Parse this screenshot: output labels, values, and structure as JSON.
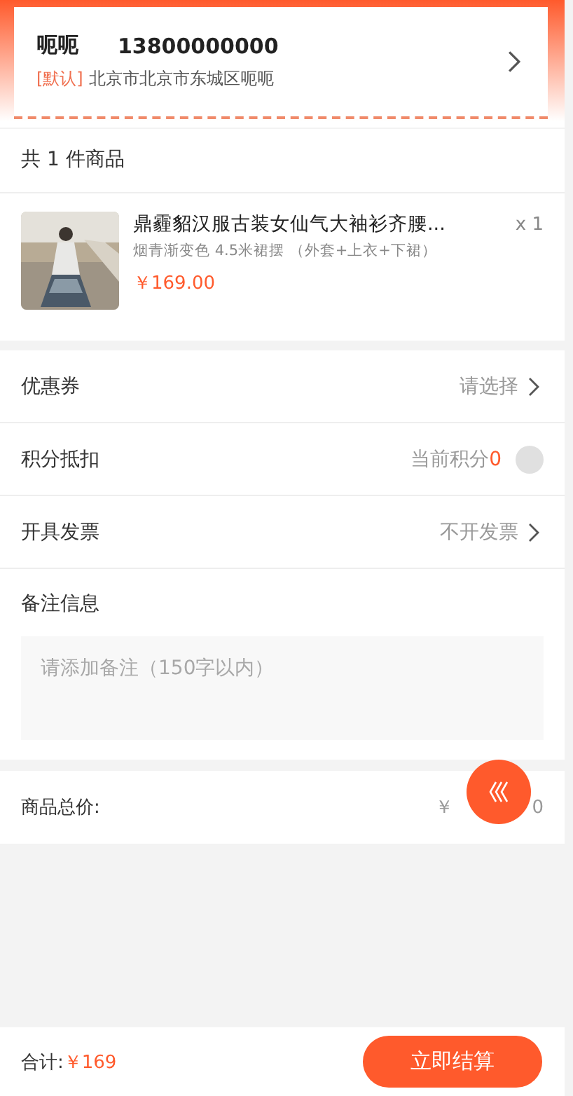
{
  "address": {
    "name": "呃呃",
    "phone": "13800000000",
    "tag": "[默认]",
    "detail": "北京市北京市东城区呃呃"
  },
  "goods_count": "共 1 件商品",
  "product": {
    "title": "鼎霾貂汉服古装女仙气大袖衫齐腰...",
    "spec": "烟青渐变色 4.5米裙摆 （外套+上衣+下裙）",
    "price": "￥169.00",
    "quantity": "x 1"
  },
  "options": [
    {
      "kind": "select",
      "label": "优惠券",
      "value": "请选择"
    },
    {
      "kind": "points",
      "label": "积分抵扣",
      "value": "当前积分",
      "points": "0",
      "on": false
    },
    {
      "kind": "select",
      "label": "开具发票",
      "value": "不开发票"
    }
  ],
  "remark": {
    "label": "备注信息",
    "placeholder": "请添加备注（150字以内）"
  },
  "total": {
    "label": "商品总价:",
    "price_start": "￥",
    "price_end": "0"
  },
  "footer": {
    "label": "合计:",
    "amount": "￥169",
    "button": "立即结算"
  }
}
